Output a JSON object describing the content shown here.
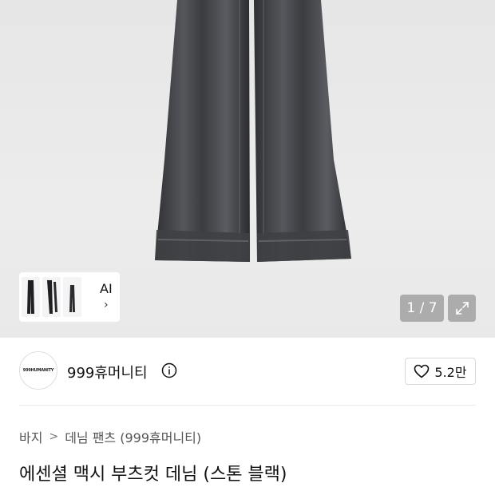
{
  "gallery": {
    "counter": "1 / 7",
    "ai_label": "AI",
    "ai_chevron": "›",
    "expand_icon": "expand-icon",
    "background_color": "#e9e9e9"
  },
  "brand": {
    "logo_text": "999HUMANITY",
    "name": "999휴머니티",
    "info_icon": "info-icon"
  },
  "like": {
    "icon": "heart-icon",
    "count": "5.2만"
  },
  "breadcrumb": {
    "items": [
      "바지",
      "데님 팬츠 (999휴머니티)"
    ],
    "separator": ">"
  },
  "product": {
    "title": "에센셜 맥시 부츠컷 데님 (스톤 블랙)"
  }
}
